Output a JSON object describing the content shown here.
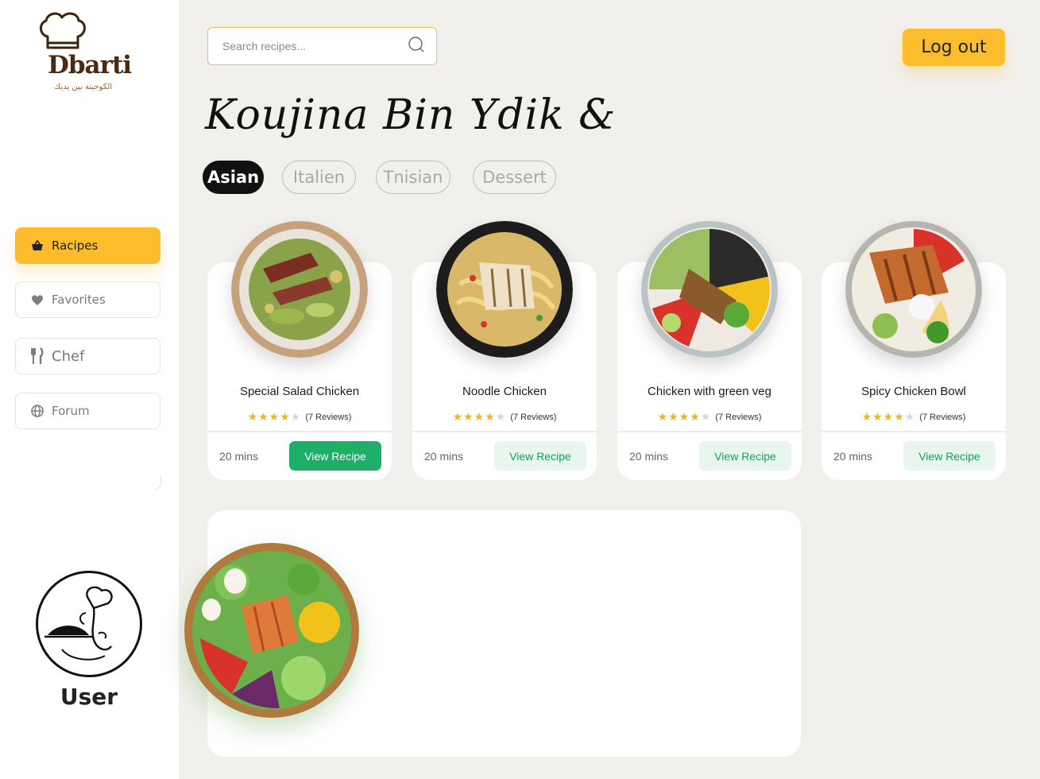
{
  "brand": {
    "name": "Dbarti",
    "tagline": "الكوجينة بين يديك"
  },
  "sidebar": {
    "items": [
      {
        "label": "Racipes",
        "icon": "basket-icon",
        "active": true
      },
      {
        "label": "Favorites",
        "icon": "heart-icon",
        "active": false
      },
      {
        "label": "Chef",
        "icon": "fork-knife-icon",
        "active": false
      },
      {
        "label": "Forum",
        "icon": "globe-icon",
        "active": false
      }
    ]
  },
  "user": {
    "name": "User"
  },
  "header": {
    "search_placeholder": "Search recipes...",
    "logout_label": "Log out"
  },
  "headline": "Koujina Bin Ydik &",
  "categories": [
    {
      "label": "Asian",
      "active": true
    },
    {
      "label": "Italien",
      "active": false
    },
    {
      "label": "Tnisian",
      "active": false
    },
    {
      "label": "Dessert",
      "active": false
    }
  ],
  "recipes": [
    {
      "title": "Special Salad Chicken",
      "rating": 4,
      "reviews": "(7 Reviews)",
      "time": "20 mins",
      "button": "View Recipe"
    },
    {
      "title": "Noodle Chicken",
      "rating": 4,
      "reviews": "(7 Reviews)",
      "time": "20 mins",
      "button": "View Recipe"
    },
    {
      "title": "Chicken with green veg",
      "rating": 4,
      "reviews": "(7 Reviews)",
      "time": "20 mins",
      "button": "View Recipe"
    },
    {
      "title": "Spicy Chicken Bowl",
      "rating": 4,
      "reviews": "(7 Reviews)",
      "time": "20 mins",
      "button": "View Recipe"
    }
  ],
  "colors": {
    "accent": "#fbbd2b",
    "green": "#1dae68",
    "dark": "#111111",
    "background": "#f2f0ec"
  }
}
